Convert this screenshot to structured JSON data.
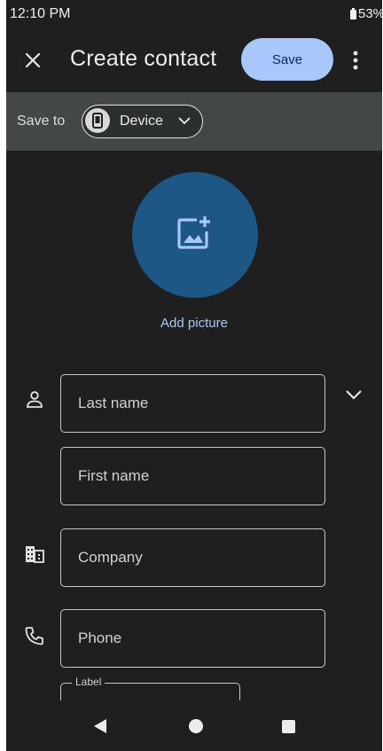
{
  "status_bar": {
    "time": "12:10 PM",
    "battery": "53%"
  },
  "app_bar": {
    "title": "Create contact",
    "save_label": "Save"
  },
  "save_to": {
    "label": "Save to",
    "account": "Device"
  },
  "avatar": {
    "add_picture_label": "Add picture"
  },
  "form": {
    "last_name_placeholder": "Last name",
    "first_name_placeholder": "First name",
    "company_placeholder": "Company",
    "phone_placeholder": "Phone",
    "phone_label_legend": "Label"
  },
  "colors": {
    "background": "#1f1f1f",
    "accent": "#a8c7fa",
    "avatar_circle": "#1d5785",
    "save_to_bar": "#434746"
  },
  "icons": [
    "close-icon",
    "more-vert-icon",
    "phone-device-icon",
    "chevron-down-icon",
    "add-photo-icon",
    "person-icon",
    "building-icon",
    "phone-icon",
    "nav-back-icon",
    "nav-home-icon",
    "nav-recents-icon"
  ]
}
